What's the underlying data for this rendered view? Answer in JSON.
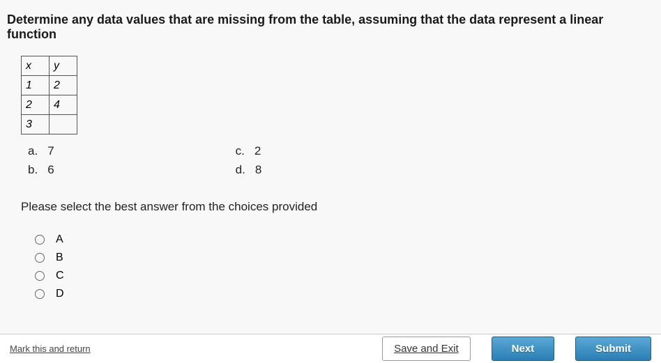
{
  "question": "Determine any data values that are missing from the table, assuming that the data represent a linear function",
  "table": {
    "header": {
      "x": "x",
      "y": "y"
    },
    "rows": [
      {
        "x": "1",
        "y": "2"
      },
      {
        "x": "2",
        "y": "4"
      },
      {
        "x": "3",
        "y": ""
      }
    ]
  },
  "answers": {
    "left": [
      {
        "letter": "a.",
        "value": "7"
      },
      {
        "letter": "b.",
        "value": "6"
      }
    ],
    "right": [
      {
        "letter": "c.",
        "value": "2"
      },
      {
        "letter": "d.",
        "value": "8"
      }
    ]
  },
  "instruction": "Please select the best answer from the choices provided",
  "choices": [
    "A",
    "B",
    "C",
    "D"
  ],
  "footer": {
    "mark": "Mark this and return",
    "save_exit": "Save and Exit",
    "next": "Next",
    "submit": "Submit"
  }
}
